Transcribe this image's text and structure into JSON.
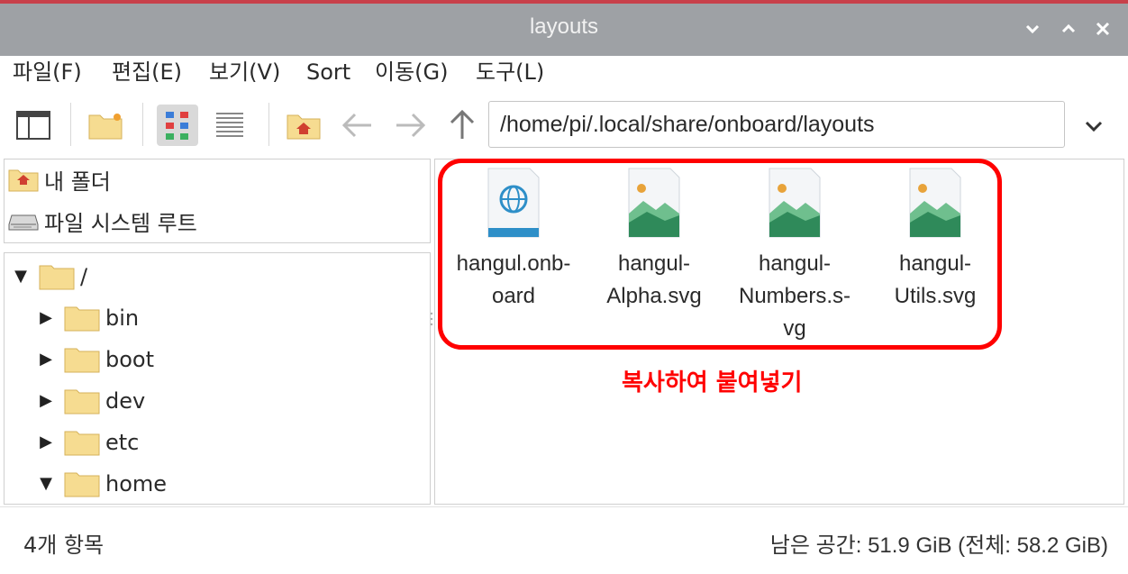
{
  "window": {
    "title": "layouts",
    "minimize_glyph": "⌄",
    "maximize_glyph": "⌃",
    "close_glyph": "✕"
  },
  "menu": [
    "파일(F)",
    "편집(E)",
    "보기(V)",
    "Sort",
    "이동(G)",
    "도구(L)"
  ],
  "toolbar": {
    "path": "/home/pi/.local/share/onboard/layouts",
    "icons": [
      "side-pane-icon",
      "new-folder-icon",
      "icon-view-icon",
      "list-view-icon",
      "home-icon",
      "back-arrow-icon",
      "forward-arrow-icon",
      "up-arrow-icon",
      "chevron-down-icon"
    ],
    "active_view": "icon-view"
  },
  "places": [
    {
      "label": "내 폴더",
      "icon": "home-folder-icon"
    },
    {
      "label": "파일 시스템 루트",
      "icon": "drive-icon"
    }
  ],
  "tree": [
    {
      "label": "/",
      "expanded": true,
      "level": 0
    },
    {
      "label": "bin",
      "expanded": false,
      "level": 1
    },
    {
      "label": "boot",
      "expanded": false,
      "level": 1
    },
    {
      "label": "dev",
      "expanded": false,
      "level": 1
    },
    {
      "label": "etc",
      "expanded": false,
      "level": 1
    },
    {
      "label": "home",
      "expanded": true,
      "level": 1
    }
  ],
  "files": [
    {
      "name": "hangul.onb-\noard",
      "icon": "globe-document-icon"
    },
    {
      "name": "hangul-\nAlpha.svg",
      "icon": "image-document-icon"
    },
    {
      "name": "hangul-\nNumbers.s-\nvg",
      "icon": "image-document-icon"
    },
    {
      "name": "hangul-\nUtils.svg",
      "icon": "image-document-icon"
    }
  ],
  "annotation": "복사하여 붙여넣기",
  "status": {
    "left": "4개 항목",
    "right": "남은 공간: 51.9 GiB (전체: 58.2 GiB)"
  },
  "colors": {
    "highlight": "#ff0000",
    "titlebar": "#9ea1a5",
    "folder": "#f6dc91"
  }
}
